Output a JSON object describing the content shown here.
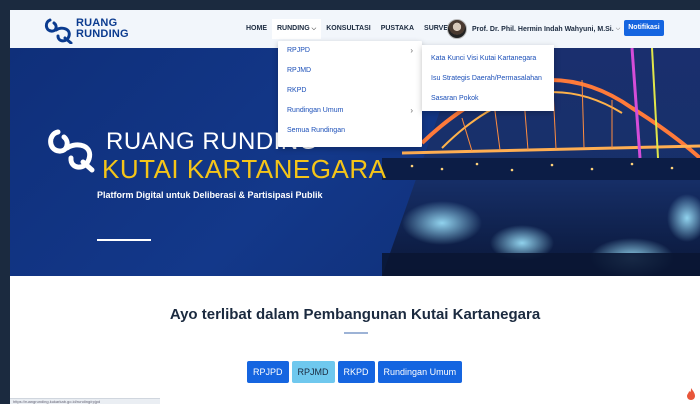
{
  "brand": {
    "line1": "RUANG",
    "line2": "RUNDING"
  },
  "nav": {
    "items": [
      {
        "label": "HOME"
      },
      {
        "label": "RUNDING"
      },
      {
        "label": "KONSULTASI"
      },
      {
        "label": "PUSTAKA"
      },
      {
        "label": "SURVEY"
      }
    ],
    "user_name": "Prof. Dr. Phil. Hermin Indah Wahyuni, M.Si.",
    "notif_label": "Notifikasi"
  },
  "dropdown": {
    "items": [
      {
        "label": "RPJPD",
        "has_sub": true
      },
      {
        "label": "RPJMD",
        "has_sub": false
      },
      {
        "label": "RKPD",
        "has_sub": false
      },
      {
        "label": "Rundingan Umum",
        "has_sub": true
      },
      {
        "label": "Semua Rundingan",
        "has_sub": false
      }
    ],
    "submenu": [
      {
        "label": "Kata Kunci Visi Kutai Kartanegara"
      },
      {
        "label": "Isu Strategis Daerah/Permasalahan"
      },
      {
        "label": "Sasaran Pokok"
      }
    ]
  },
  "hero": {
    "title_line1": "RUANG RUNDING",
    "title_line2": "KUTAI KARTANEGARA",
    "subtitle": "Platform Digital untuk Deliberasi & Partisipasi Publik"
  },
  "section": {
    "title": "Ayo terlibat dalam Pembangunan Kutai Kartanegara",
    "tabs": [
      {
        "label": "RPJPD"
      },
      {
        "label": "RPJMD"
      },
      {
        "label": "RKPD"
      },
      {
        "label": "Rundingan Umum"
      }
    ]
  },
  "statusbar": {
    "url": "https://ruangrunding.kukarkab.go.id/runding/rpjpd"
  },
  "colors": {
    "primary": "#1565e0",
    "accent": "#f5c518",
    "hero_bg": "#13388a",
    "tab_active": "#6fc8ee"
  }
}
